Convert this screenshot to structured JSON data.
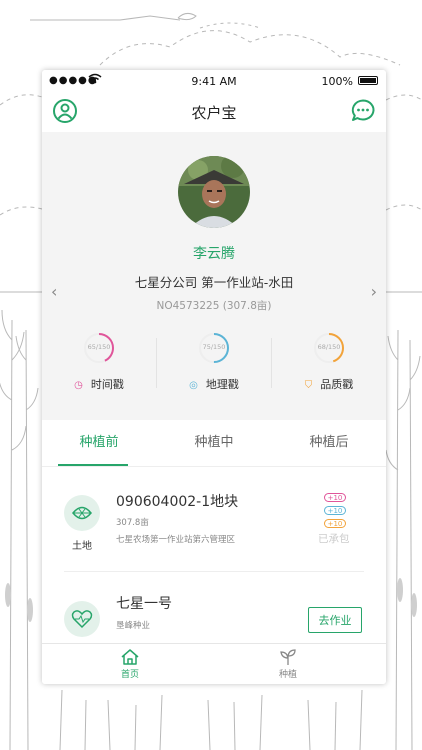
{
  "statusbar": {
    "carrier": "●●●●●",
    "time": "9:41 AM",
    "battery": "100%"
  },
  "navbar": {
    "title": "农户宝",
    "left_icon": "user-icon",
    "right_icon": "chat-icon"
  },
  "profile": {
    "name": "李云腾",
    "company": "七星分公司 第一作业站-水田",
    "id_line": "NO4573225 (307.8亩)",
    "prev_arrow": "‹",
    "next_arrow": "›"
  },
  "stats": [
    {
      "ring_text": "65/150",
      "label": "时间戳",
      "color": "#e0559a",
      "fraction": 0.43,
      "icon": "clock-icon",
      "icon_glyph": "◷"
    },
    {
      "ring_text": "75/150",
      "label": "地理戳",
      "color": "#5bb4d6",
      "fraction": 0.5,
      "icon": "globe-icon",
      "icon_glyph": "◎"
    },
    {
      "ring_text": "68/150",
      "label": "品质戳",
      "color": "#f2a33a",
      "fraction": 0.45,
      "icon": "shield-icon",
      "icon_glyph": "⛉"
    }
  ],
  "tabs": [
    {
      "label": "种植前",
      "active": true
    },
    {
      "label": "种植中",
      "active": false
    },
    {
      "label": "种植后",
      "active": false
    }
  ],
  "items": [
    {
      "type": "土地",
      "icon": "leaf-icon",
      "title": "090604002-1地块",
      "sub1": "307.8亩",
      "sub2": "七星农场第一作业站第六管理区",
      "badges": [
        {
          "text": "+10",
          "color": "#e0559a"
        },
        {
          "text": "+10",
          "color": "#5bb4d6"
        },
        {
          "text": "+10",
          "color": "#f2a33a"
        }
      ],
      "status": "已承包"
    },
    {
      "icon": "heart-icon",
      "title": "七星一号",
      "sub1": "垦峰种业",
      "button": "去作业"
    }
  ],
  "tabbar": [
    {
      "label": "首页",
      "icon": "home-icon",
      "active": true
    },
    {
      "label": "种植",
      "icon": "sprout-icon",
      "active": false
    }
  ],
  "colors": {
    "accent": "#27a56a",
    "inactive": "#888888"
  }
}
